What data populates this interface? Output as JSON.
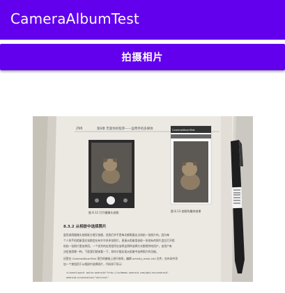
{
  "app": {
    "title": "CameraAlbumTest"
  },
  "actions": {
    "take_photo_label": "拍摄相片"
  },
  "photo": {
    "alt": "拍摄的书页照片",
    "page_number": "296",
    "running_header": "第8章 丰富你的程序——运用手机多媒体",
    "phone_screen_title": "CameraAlbumTest",
    "figure_caption_left": "图 8.12 打开摄像头拍照",
    "figure_caption_right": "图 8.13 拍照的最终效果",
    "section_heading": "8.3.2 从相册中选择照片",
    "body_lines": [
      "虽然调用摄像头拍照既方便又快捷，但我们并不是每次都需要去当场拍一张照片的，因为每",
      "个人的手机相册里应该都会存有许许多多张照片，直接从相册里选取一张现有的照片会比打开相",
      "机拍一张照片更加常用。一个优秀的应用程序应该将这两种选择方式都提供给用户，由用户来",
      "决定使用哪一种。下面我们就来看一下，如何才能实现从相册中选择照片的功能。",
      "还是在 CameraAlbumTest 项目的基础上进行修改，编辑 activity_main.xml 文件，在布局中添",
      "加一个按钮用于从相册中选择照片，代码如下所示："
    ],
    "code_lines": [
      "<LinearLayout xmlns:android=\"http://schemas.android.com/apk/res/android\"",
      "    android:orientation=\"vertical\""
    ]
  },
  "colors": {
    "primary": "#6200ee",
    "on_primary": "#ffffff",
    "background": "#ffffff"
  }
}
